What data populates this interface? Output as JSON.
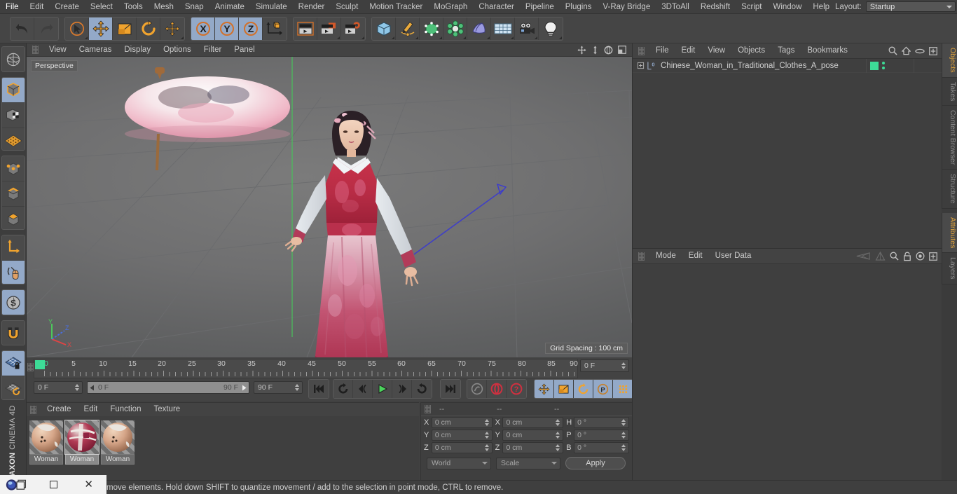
{
  "app": {
    "brand_bold": "MAXON",
    "brand_light": "CINEMA 4D"
  },
  "main_menu": {
    "items": [
      "File",
      "Edit",
      "Create",
      "Select",
      "Tools",
      "Mesh",
      "Snap",
      "Animate",
      "Simulate",
      "Render",
      "Sculpt",
      "Motion Tracker",
      "MoGraph",
      "Character",
      "Pipeline",
      "Plugins",
      "V-Ray Bridge",
      "3DToAll",
      "Redshift",
      "Script",
      "Window",
      "Help"
    ],
    "layout_label": "Layout:",
    "layout_value": "Startup"
  },
  "toolbar": {
    "undo": "undo-icon",
    "redo": "redo-icon",
    "select": "live-selection-icon",
    "move": "move-icon",
    "scale": "scale-icon",
    "rotate": "rotate-icon",
    "axis_move": "axis-move-icon",
    "lock_x": "X",
    "lock_y": "Y",
    "lock_z": "Z",
    "world_object": "world-object-axis-icon",
    "render_view": "render-view-icon",
    "render_region": "render-region-icon",
    "render_settings": "render-settings-icon",
    "primitives": "cube-primitive-icon",
    "spline": "pen-spline-icon",
    "generators": "generator-icon",
    "deformers": "deformer-icon",
    "environment": "environment-icon",
    "scene": "floor-scene-icon",
    "camera": "camera-icon",
    "light": "light-icon"
  },
  "left_toolbar": {
    "items": [
      {
        "name": "world-axis-icon",
        "active": false
      },
      {
        "name": "model-mode-icon",
        "active": true
      },
      {
        "name": "texture-mode-icon",
        "active": false
      },
      {
        "name": "workplane-icon",
        "active": false
      },
      {
        "name": "points-mode-icon",
        "active": false
      },
      {
        "name": "edges-mode-icon",
        "active": false
      },
      {
        "name": "polygons-mode-icon",
        "active": false
      },
      {
        "name": "object-axis-icon",
        "active": false
      },
      {
        "name": "enable-axis-icon",
        "active": true
      },
      {
        "name": "snap-icon",
        "active": true
      },
      {
        "name": "magnet-icon",
        "active": false
      },
      {
        "name": "lock-workplane-icon",
        "active": true
      },
      {
        "name": "planar-workplane-icon",
        "active": false
      }
    ]
  },
  "viewport": {
    "menu": [
      "View",
      "Cameras",
      "Display",
      "Options",
      "Filter",
      "Panel"
    ],
    "perspective_label": "Perspective",
    "grid_spacing": "Grid Spacing : 100 cm",
    "nav_icons": [
      "pan-icon",
      "dolly-icon",
      "orbit-icon",
      "maximize-viewport-icon"
    ],
    "axis_x": "X",
    "axis_y": "Y",
    "axis_z": "Z"
  },
  "timeline": {
    "ticks": [
      "0",
      "5",
      "10",
      "15",
      "20",
      "25",
      "30",
      "35",
      "40",
      "45",
      "50",
      "55",
      "60",
      "65",
      "70",
      "75",
      "80",
      "85",
      "90"
    ],
    "current_frame": "0 F",
    "current_frame_right": "0 F",
    "range_start": "0 F",
    "range_end": "90 F",
    "max_frame": "90 F",
    "buttons": [
      {
        "name": "go-to-start-button",
        "glyph": "|◀◀"
      },
      {
        "name": "previous-key-button",
        "glyph": "↺"
      },
      {
        "name": "previous-frame-button",
        "glyph": "◀("
      },
      {
        "name": "play-button",
        "glyph": "▶"
      },
      {
        "name": "next-frame-button",
        "glyph": ")▶"
      },
      {
        "name": "next-key-button",
        "glyph": "↻"
      },
      {
        "name": "go-to-end-button",
        "glyph": "▶▶|"
      },
      {
        "name": "record-active-objects-button",
        "glyph": "◉"
      },
      {
        "name": "autokeying-button",
        "glyph": "◍"
      },
      {
        "name": "keyframe-selection-button",
        "glyph": "?"
      },
      {
        "name": "position-key-button",
        "glyph": "✛"
      },
      {
        "name": "scale-key-button",
        "glyph": "▣"
      },
      {
        "name": "rotation-key-button",
        "glyph": "↻"
      },
      {
        "name": "param-key-button",
        "glyph": "P"
      },
      {
        "name": "point-level-animation-button",
        "glyph": "⣿"
      },
      {
        "name": "timeline-button",
        "glyph": "▤"
      }
    ]
  },
  "material_manager": {
    "menu": [
      "Create",
      "Edit",
      "Function",
      "Texture"
    ],
    "materials": [
      {
        "name": "Woman",
        "selected": false
      },
      {
        "name": "Woman",
        "selected": true
      },
      {
        "name": "Woman",
        "selected": false
      }
    ]
  },
  "coordinates": {
    "headers": [
      "--",
      "--",
      "--"
    ],
    "rows": [
      {
        "pos_label": "X",
        "pos_value": "0 cm",
        "size_label": "X",
        "size_value": "0 cm",
        "rot_label": "H",
        "rot_value": "0 °"
      },
      {
        "pos_label": "Y",
        "pos_value": "0 cm",
        "size_label": "Y",
        "size_value": "0 cm",
        "rot_label": "P",
        "rot_value": "0 °"
      },
      {
        "pos_label": "Z",
        "pos_value": "0 cm",
        "size_label": "Z",
        "size_value": "0 cm",
        "rot_label": "B",
        "rot_value": "0 °"
      }
    ],
    "system": "World",
    "mode": "Scale",
    "apply": "Apply"
  },
  "object_manager": {
    "menu": [
      "File",
      "Edit",
      "View",
      "Objects",
      "Tags",
      "Bookmarks"
    ],
    "icons": [
      "search-icon",
      "home-icon",
      "ellipse-icon",
      "expand-icon"
    ],
    "objects": [
      {
        "name": "Chinese_Woman_in_Traditional_Clothes_A_pose",
        "layer_badge": "0"
      }
    ]
  },
  "attribute_manager": {
    "menu": [
      "Mode",
      "Edit",
      "User Data"
    ],
    "icons": [
      "back-icon",
      "forward-icon",
      "search-icon",
      "lock-icon",
      "target-icon",
      "expand-icon"
    ]
  },
  "right_tabs": {
    "top": [
      "Objects",
      "Takes",
      "Content Browser",
      "Structure"
    ],
    "top_active": "Objects",
    "bottom": [
      "Attributes",
      "Layers"
    ],
    "bottom_active": "Attributes"
  },
  "status_bar": {
    "message": "Click and drag to move elements. Hold down SHIFT to quantize movement / add to the selection in point mode, CTRL to remove.",
    "visible_message": "move elements. Hold down SHIFT to quantize movement / add to the selection in point mode, CTRL to remove."
  },
  "taskbar": {
    "items": [
      "browser-icon",
      "window-restore-icon",
      "close-icon"
    ]
  },
  "colors": {
    "accent_orange": "#e2a43c",
    "highlight_blue": "#93a9c8",
    "green_chip": "#3ddc97",
    "panel_bg": "#3f3f3f"
  }
}
